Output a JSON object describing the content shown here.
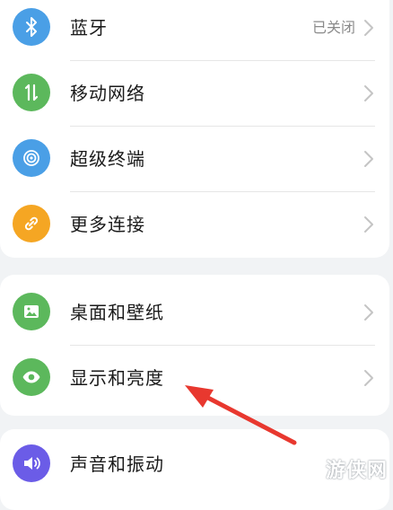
{
  "settings": {
    "group1": [
      {
        "label": "蓝牙",
        "value": "已关闭",
        "icon": "bluetooth-icon",
        "color": "#4a9fe6"
      },
      {
        "label": "移动网络",
        "value": "",
        "icon": "mobile-data-icon",
        "color": "#5cb85c"
      },
      {
        "label": "超级终端",
        "value": "",
        "icon": "super-device-icon",
        "color": "#4a9fe6"
      },
      {
        "label": "更多连接",
        "value": "",
        "icon": "link-icon",
        "color": "#f5a623"
      }
    ],
    "group2": [
      {
        "label": "桌面和壁纸",
        "value": "",
        "icon": "wallpaper-icon",
        "color": "#5cb85c"
      },
      {
        "label": "显示和亮度",
        "value": "",
        "icon": "eye-icon",
        "color": "#5cb85c"
      }
    ],
    "group3": [
      {
        "label": "声音和振动",
        "value": "",
        "icon": "speaker-icon",
        "color": "#6b5ce7"
      }
    ]
  },
  "watermark": "游侠网",
  "annotation": {
    "type": "arrow",
    "color": "#e8382f",
    "points_to": "显示和亮度"
  }
}
